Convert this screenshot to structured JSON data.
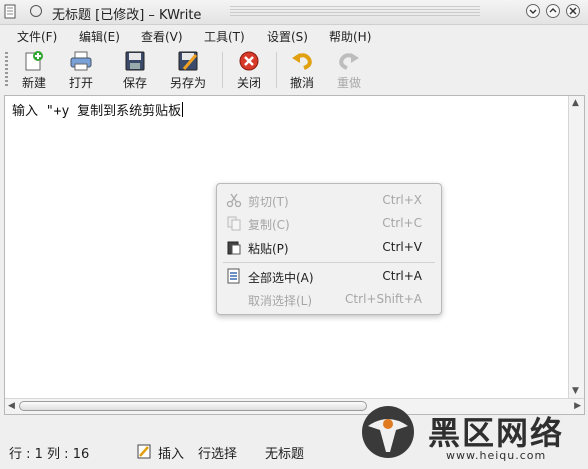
{
  "window": {
    "title": "无标题 [已修改] – KWrite"
  },
  "menubar": {
    "items": [
      {
        "label": "文件(F)"
      },
      {
        "label": "编辑(E)"
      },
      {
        "label": "查看(V)"
      },
      {
        "label": "工具(T)"
      },
      {
        "label": "设置(S)"
      },
      {
        "label": "帮助(H)"
      }
    ]
  },
  "toolbar": {
    "items": [
      {
        "label": "新建",
        "icon": "new-document-icon",
        "enabled": true
      },
      {
        "label": "打开",
        "icon": "open-printer-icon",
        "enabled": true
      },
      {
        "label": "保存",
        "icon": "save-disk-icon",
        "enabled": true
      },
      {
        "label": "另存为",
        "icon": "save-as-icon",
        "enabled": true
      },
      {
        "label": "关闭",
        "icon": "close-red-icon",
        "enabled": true
      },
      {
        "label": "撤消",
        "icon": "undo-icon",
        "enabled": true
      },
      {
        "label": "重做",
        "icon": "redo-icon",
        "enabled": false
      }
    ]
  },
  "editor": {
    "text": "输入 \"+y 复制到系统剪贴板"
  },
  "context_menu": {
    "items": [
      {
        "label": "剪切(T)",
        "shortcut": "Ctrl+X",
        "icon": "scissors-icon",
        "enabled": false
      },
      {
        "label": "复制(C)",
        "shortcut": "Ctrl+C",
        "icon": "copy-icon",
        "enabled": false
      },
      {
        "label": "粘贴(P)",
        "shortcut": "Ctrl+V",
        "icon": "paste-icon",
        "enabled": true
      },
      {
        "label": "全部选中(A)",
        "shortcut": "Ctrl+A",
        "icon": "select-all-icon",
        "enabled": true
      },
      {
        "label": "取消选择(L)",
        "shortcut": "Ctrl+Shift+A",
        "icon": "",
        "enabled": false
      }
    ]
  },
  "statusbar": {
    "position": "行 : 1 列 : 16",
    "mode": "插入",
    "selection": "行选择",
    "filename": "无标题"
  },
  "watermark": {
    "text": "黑区网络",
    "url": "www.heiqu.com"
  },
  "colors": {
    "accent_red": "#d83a2a",
    "accent_orange": "#f0a020",
    "green": "#35a535"
  }
}
